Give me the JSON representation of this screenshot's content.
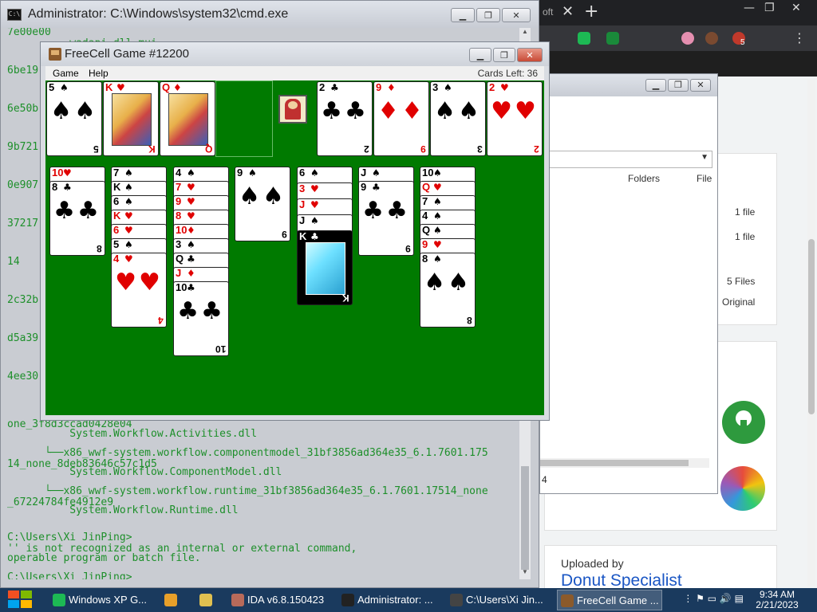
{
  "cmd": {
    "title": "Administrator: C:\\Windows\\system32\\cmd.exe",
    "lines": [
      "7e00e00",
      "          wadapi.dll.mui",
      "6be19",
      "6e50b",
      "9b721",
      "0e907",
      "37217",
      "14",
      "2c32b",
      "d5a39",
      "4ee30",
      "one_3f8d3ccad0428e04",
      "          System.Workflow.Activities.dll",
      "      └──x86_wwf-system.workflow.componentmodel_31bf3856ad364e35_6.1.7601.175",
      "14_none_8deb83646c57c1d5",
      "          System.Workflow.ComponentModel.dll",
      "      └──x86_wwf-system.workflow.runtime_31bf3856ad364e35_6.1.7601.17514_none",
      "_67224784fe4912e9",
      "          System.Workflow.Runtime.dll",
      "",
      "C:\\Users\\Xi JinPing>",
      "'' is not recognized as an internal or external command,",
      "operable program or batch file.",
      "",
      "C:\\Users\\Xi JinPing>"
    ]
  },
  "browser": {
    "tab_fragment": "oft",
    "close_glyph": "✕",
    "new_tab_glyph": "+",
    "ctl_min": "—",
    "ctl_max": "❐",
    "ctl_close": "✕",
    "menu_glyph": "⋮",
    "ext_badge": "5",
    "uploaded_by": "Uploaded by",
    "uploader": "Donut Specialist",
    "file_rows": [
      "1 file",
      "1 file",
      "5 Files",
      "Original"
    ]
  },
  "explorer": {
    "col_folders": "Folders",
    "col_file": "File",
    "status": "4"
  },
  "freecell": {
    "title": "FreeCell Game #12200",
    "menu": [
      "Game",
      "Help"
    ],
    "cards_left": "Cards Left: 36",
    "free_cells": [
      {
        "rank": "5",
        "suit": "♠",
        "color": "blk",
        "face": false
      },
      {
        "rank": "K",
        "suit": "♥",
        "color": "red",
        "face": true
      },
      {
        "rank": "Q",
        "suit": "♦",
        "color": "red",
        "face": true
      }
    ],
    "foundations": [
      {
        "rank": "2",
        "suit": "♣",
        "color": "blk"
      },
      {
        "rank": "9",
        "suit": "♦",
        "color": "red"
      },
      {
        "rank": "3",
        "suit": "♠",
        "color": "blk"
      },
      {
        "rank": "2",
        "suit": "♥",
        "color": "red"
      }
    ],
    "columns": [
      [
        {
          "r": "10",
          "s": "♥",
          "c": "red"
        },
        {
          "r": "8",
          "s": "♣",
          "c": "blk"
        }
      ],
      [
        {
          "r": "7",
          "s": "♠",
          "c": "blk"
        },
        {
          "r": "K",
          "s": "♠",
          "c": "blk"
        },
        {
          "r": "6",
          "s": "♠",
          "c": "blk"
        },
        {
          "r": "K",
          "s": "♥",
          "c": "red"
        },
        {
          "r": "6",
          "s": "♥",
          "c": "red"
        },
        {
          "r": "5",
          "s": "♠",
          "c": "blk"
        },
        {
          "r": "4",
          "s": "♥",
          "c": "red"
        }
      ],
      [
        {
          "r": "4",
          "s": "♠",
          "c": "blk"
        },
        {
          "r": "7",
          "s": "♥",
          "c": "red"
        },
        {
          "r": "9",
          "s": "♥",
          "c": "red"
        },
        {
          "r": "8",
          "s": "♥",
          "c": "red"
        },
        {
          "r": "10",
          "s": "♦",
          "c": "red"
        },
        {
          "r": "3",
          "s": "♠",
          "c": "blk"
        },
        {
          "r": "Q",
          "s": "♣",
          "c": "blk"
        },
        {
          "r": "J",
          "s": "♦",
          "c": "red"
        },
        {
          "r": "10",
          "s": "♣",
          "c": "blk"
        }
      ],
      [
        {
          "r": "9",
          "s": "♠",
          "c": "blk"
        }
      ],
      [
        {
          "r": "6",
          "s": "♠",
          "c": "blk"
        },
        {
          "r": "3",
          "s": "♥",
          "c": "red"
        },
        {
          "r": "J",
          "s": "♥",
          "c": "red"
        },
        {
          "r": "J",
          "s": "♠",
          "c": "blk"
        },
        {
          "r": "K",
          "s": "♣",
          "c": "blk",
          "sel": true
        }
      ],
      [
        {
          "r": "J",
          "s": "♠",
          "c": "blk"
        },
        {
          "r": "9",
          "s": "♣",
          "c": "blk"
        }
      ],
      [
        {
          "r": "10",
          "s": "♠",
          "c": "blk"
        },
        {
          "r": "Q",
          "s": "♥",
          "c": "red"
        },
        {
          "r": "7",
          "s": "♠",
          "c": "blk"
        },
        {
          "r": "4",
          "s": "♠",
          "c": "blk"
        },
        {
          "r": "Q",
          "s": "♠",
          "c": "blk"
        },
        {
          "r": "9",
          "s": "♥",
          "c": "red"
        },
        {
          "r": "8",
          "s": "♠",
          "c": "blk"
        }
      ]
    ]
  },
  "taskbar": {
    "items": [
      {
        "label": "Windows XP G...",
        "color": "#1db954"
      },
      {
        "label": "",
        "color": "#e8a02a"
      },
      {
        "label": "",
        "color": "#e0c050"
      },
      {
        "label": "IDA v6.8.150423",
        "color": "#b86a5a"
      },
      {
        "label": "Administrator: ...",
        "color": "#222222"
      },
      {
        "label": "C:\\Users\\Xi Jin...",
        "color": "#444444"
      },
      {
        "label": "FreeCell Game ...",
        "color": "#8b5a2b"
      }
    ],
    "time": "9:34 AM",
    "date": "2/21/2023"
  },
  "colors": {
    "felt": "#007a00",
    "console_text": "#1d8f2a",
    "taskbar": "#1a3a5e"
  }
}
